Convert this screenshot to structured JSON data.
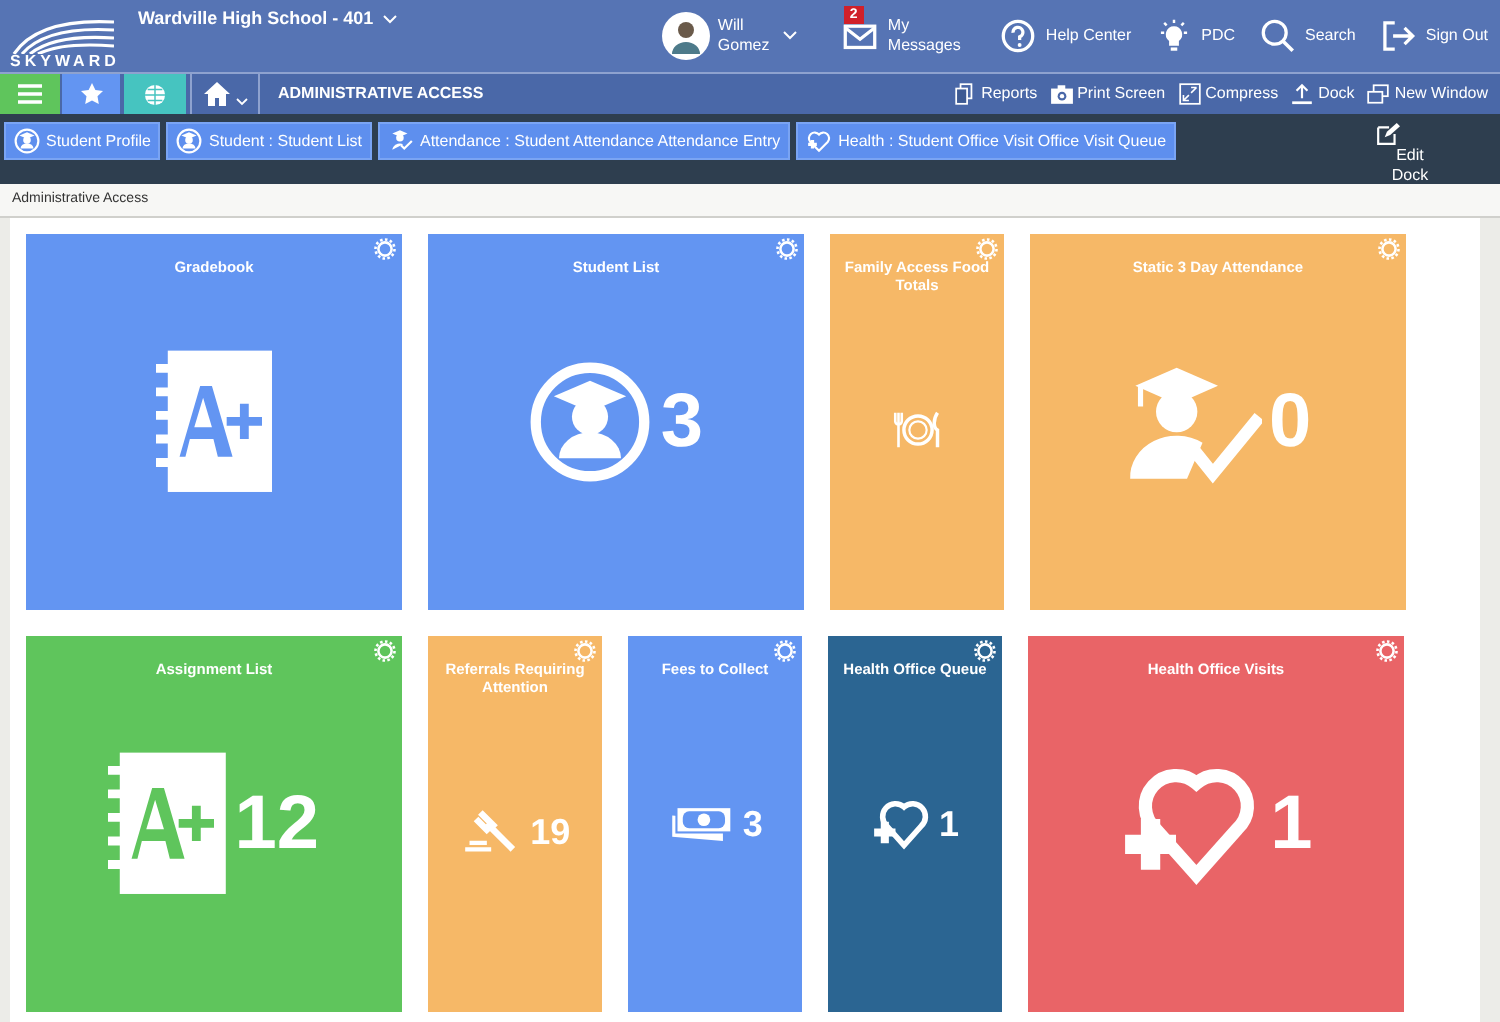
{
  "header": {
    "logo": "SKYWARD",
    "school": "Wardville High School - 401",
    "user": "Will Gomez",
    "nav": [
      {
        "kind": "messages",
        "label": "My Messages",
        "badge": "2"
      },
      {
        "kind": "help",
        "label": "Help Center"
      },
      {
        "kind": "bulb",
        "label": "PDC"
      },
      {
        "kind": "search",
        "label": "Search"
      },
      {
        "kind": "signout",
        "label": "Sign Out"
      }
    ]
  },
  "toolbar": {
    "title": "ADMINISTRATIVE ACCESS",
    "actions": [
      {
        "kind": "reports",
        "label": "Reports"
      },
      {
        "kind": "camera",
        "label": "Print Screen"
      },
      {
        "kind": "compress",
        "label": "Compress"
      },
      {
        "kind": "dock",
        "label": "Dock"
      },
      {
        "kind": "window",
        "label": "New Window"
      }
    ]
  },
  "dock": {
    "items": [
      {
        "kind": "student",
        "label": "Student Profile"
      },
      {
        "kind": "student",
        "label": "Student : Student List"
      },
      {
        "kind": "attendance",
        "label": "Attendance : Student Attendance Attendance Entry"
      },
      {
        "kind": "health",
        "label": "Health : Student Office Visit Office Visit Queue"
      }
    ],
    "edit": "Edit Dock"
  },
  "breadcrumb": "Administrative Access",
  "tile_rows": [
    [
      {
        "title": "Gradebook",
        "kind": "gradebook",
        "wide": true,
        "color": "#6395f2"
      },
      {
        "title": "Student List",
        "kind": "student",
        "wide": true,
        "color": "#6395f2",
        "value": "3"
      },
      {
        "title": "Family Access Food Totals",
        "kind": "food",
        "wide": false,
        "color": "#f6b867"
      },
      {
        "title": "Static 3 Day Attendance",
        "kind": "attendance",
        "wide": true,
        "color": "#f6b867",
        "value": "0"
      }
    ],
    [
      {
        "title": "Assignment List",
        "kind": "gradebook",
        "wide": true,
        "color": "#5fc55c",
        "value": "12"
      },
      {
        "title": "Referrals Requiring Attention",
        "kind": "gavel",
        "wide": false,
        "color": "#f6b867",
        "value": "19"
      },
      {
        "title": "Fees to Collect",
        "kind": "money",
        "wide": false,
        "color": "#6395f2",
        "value": "3"
      },
      {
        "title": "Health Office Queue",
        "kind": "health",
        "wide": false,
        "color": "#2b6592",
        "value": "1"
      },
      {
        "title": "Health Office Visits",
        "kind": "health",
        "wide": true,
        "color": "#e96467",
        "value": "1"
      }
    ]
  ]
}
